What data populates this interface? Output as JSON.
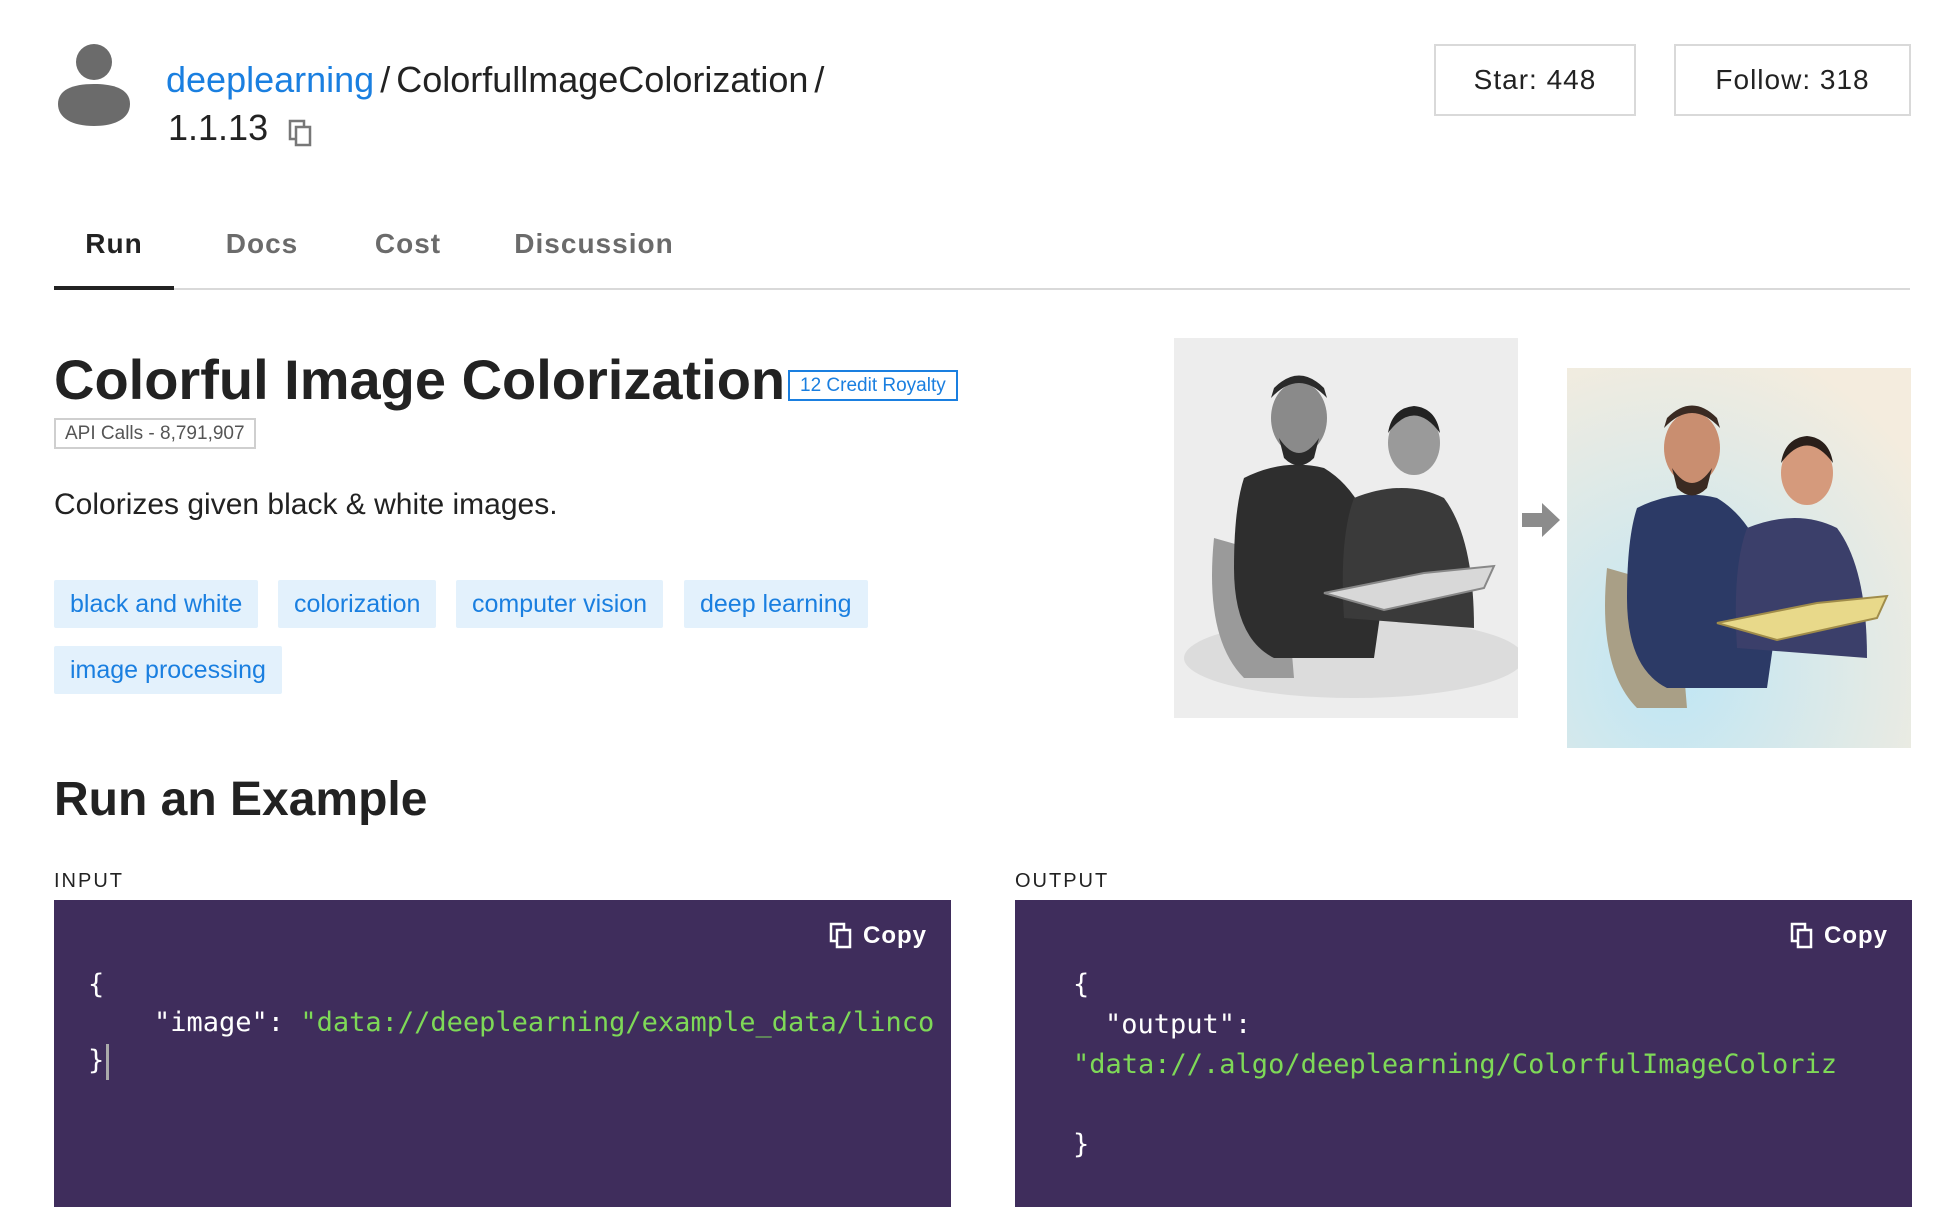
{
  "header": {
    "owner": "deeplearning",
    "separator": "/",
    "algorithm": "ColorfullmageColorization",
    "trailing_separator": "/",
    "version": "1.1.13",
    "star_label": "Star: 448",
    "follow_label": "Follow: 318"
  },
  "tabs": [
    {
      "label": "Run",
      "active": true
    },
    {
      "label": "Docs",
      "active": false
    },
    {
      "label": "Cost",
      "active": false
    },
    {
      "label": "Discussion",
      "active": false
    }
  ],
  "algo": {
    "title": "Colorful Image Colorization",
    "royalty_badge": "12 Credit Royalty",
    "api_calls": "API Calls - 8,791,907",
    "description": "Colorizes given black & white images.",
    "tags": [
      "black and white",
      "colorization",
      "computer vision",
      "deep learning",
      "image processing"
    ]
  },
  "example": {
    "title": "Run an Example",
    "input_label": "INPUT",
    "output_label": "OUTPUT",
    "copy_label": "Copy",
    "input": {
      "open_brace": "{",
      "key": "\"image\"",
      "colon": ": ",
      "value": "\"data://deeplearning/example_data/linco",
      "close_brace": "}"
    },
    "output": {
      "open_brace": "{",
      "key": "\"output\"",
      "colon": ":",
      "value": "\"data://.algo/deeplearning/ColorfulImageColoriz",
      "close_brace": "}"
    }
  },
  "colors": {
    "link": "#1a7fe0",
    "tag_bg": "#e3f1fc",
    "code_bg": "#3f2d5c",
    "code_string": "#7ed957"
  }
}
